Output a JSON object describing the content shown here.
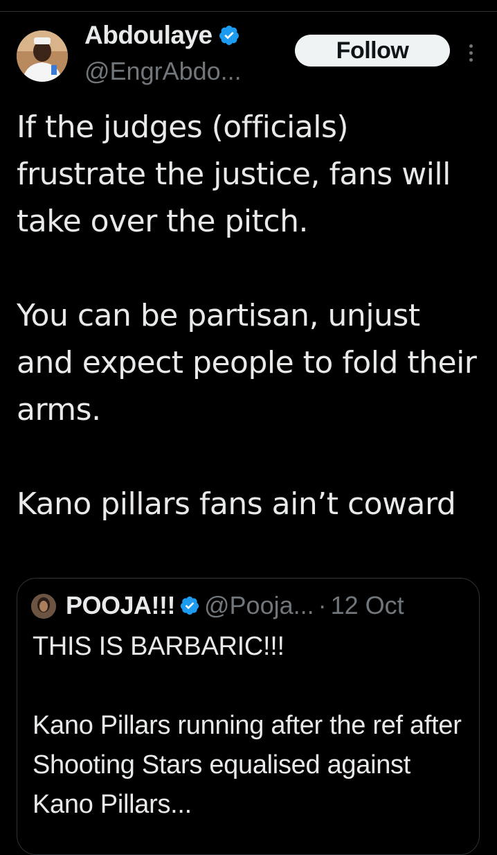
{
  "author": {
    "name": "Abdoulaye",
    "handle": "@EngrAbdo...",
    "verified_color": "#1d9bf0"
  },
  "actions": {
    "follow_label": "Follow",
    "more_icon": "more-vertical-icon"
  },
  "tweet": {
    "paragraphs": [
      "If the judges (officials) frustrate the justice, fans will take over the pitch.",
      "You can be partisan, unjust and expect people to fold their arms.",
      "Kano pillars fans ain’t coward"
    ]
  },
  "quoted": {
    "name": "POOJA!!!",
    "handle": "@Pooja...",
    "separator": "·",
    "date": "12 Oct",
    "paragraphs": [
      "THIS IS BARBARIC!!!",
      "Kano Pillars running after the ref after Shooting Stars equalised against Kano Pillars..."
    ]
  },
  "colors": {
    "background": "#000000",
    "text": "#e7e9ea",
    "secondary": "#71767b",
    "border": "#2f3336",
    "accent": "#1d9bf0"
  }
}
